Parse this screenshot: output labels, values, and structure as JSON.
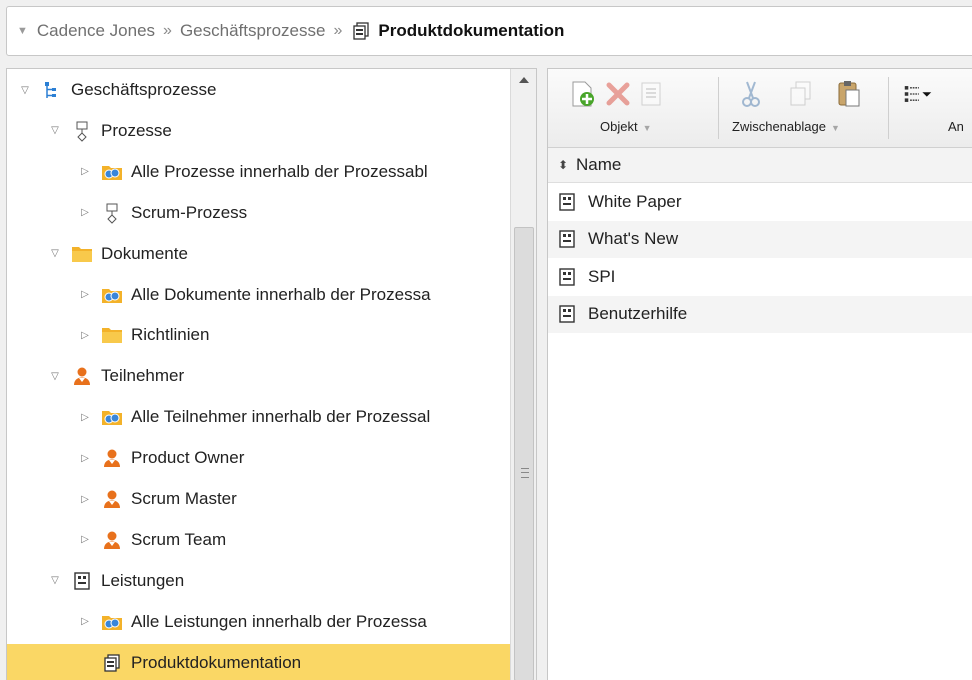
{
  "breadcrumb": {
    "items": [
      "Cadence Jones",
      "Geschäftsprozesse"
    ],
    "separator": "»",
    "current": "Produktdokumentation"
  },
  "tree": [
    {
      "label": "Geschäftsprozesse",
      "icon": "hierarchy-icon",
      "level": 0,
      "expanded": true
    },
    {
      "label": "Prozesse",
      "icon": "process-icon",
      "level": 1,
      "expanded": true
    },
    {
      "label": "Alle Prozesse innerhalb der Prozessabl",
      "icon": "all-folder-icon",
      "level": 2,
      "expanded": false
    },
    {
      "label": "Scrum-Prozess",
      "icon": "process-icon",
      "level": 2,
      "expanded": false
    },
    {
      "label": "Dokumente",
      "icon": "folder-icon",
      "level": 1,
      "expanded": true
    },
    {
      "label": "Alle Dokumente innerhalb der Prozessa",
      "icon": "all-folder-icon",
      "level": 2,
      "expanded": false
    },
    {
      "label": "Richtlinien",
      "icon": "folder-icon",
      "level": 2,
      "expanded": false
    },
    {
      "label": "Teilnehmer",
      "icon": "person-icon",
      "level": 1,
      "expanded": true
    },
    {
      "label": "Alle Teilnehmer innerhalb der Prozessal",
      "icon": "all-folder-icon",
      "level": 2,
      "expanded": false
    },
    {
      "label": "Product Owner",
      "icon": "person-icon",
      "level": 2,
      "expanded": false
    },
    {
      "label": "Scrum Master",
      "icon": "person-icon",
      "level": 2,
      "expanded": false
    },
    {
      "label": "Scrum Team",
      "icon": "person-icon",
      "level": 2,
      "expanded": false
    },
    {
      "label": "Leistungen",
      "icon": "deliverable-icon",
      "level": 1,
      "expanded": true
    },
    {
      "label": "Alle Leistungen innerhalb der Prozessa",
      "icon": "all-folder-icon",
      "level": 2,
      "expanded": false
    },
    {
      "label": "Produktdokumentation",
      "icon": "deliverable-group-icon",
      "level": 2,
      "expanded": null,
      "selected": true
    }
  ],
  "toolbar": {
    "objekt_label": "Objekt",
    "zwischenablage_label": "Zwischenablage",
    "ansicht_label": "An"
  },
  "grid": {
    "column_header": "Name",
    "rows": [
      "White Paper",
      "What's New",
      "SPI",
      "Benutzerhilfe"
    ]
  },
  "colors": {
    "selection": "#fad765",
    "folder": "#f3b22a",
    "person": "#e8711c",
    "add_green": "#49a52a",
    "delete_red": "#d73a2a"
  }
}
